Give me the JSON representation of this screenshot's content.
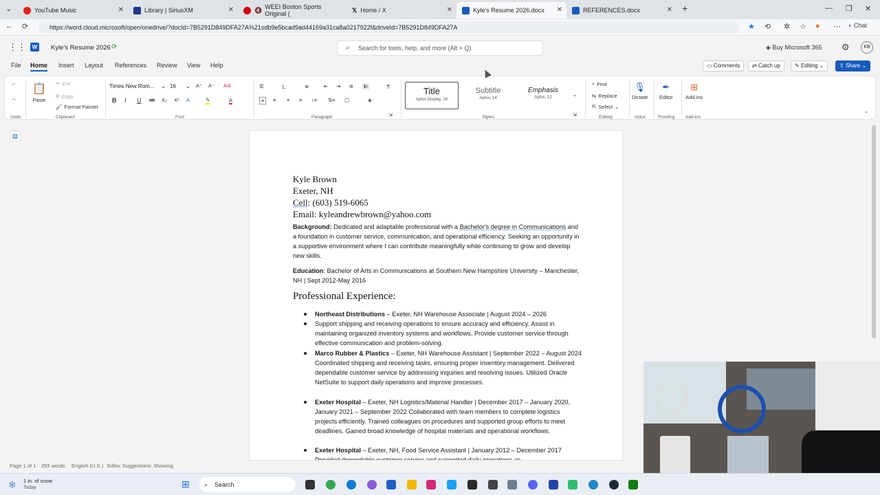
{
  "browser": {
    "tabs": [
      {
        "title": "YouTube Music",
        "color": "#e62117"
      },
      {
        "title": "Library | SiriusXM",
        "color": "#1e3a8a"
      },
      {
        "title": "WEEI Boston Sports Original (",
        "color": "#d40000"
      },
      {
        "title": "Home / X",
        "color": "#000000"
      },
      {
        "title": "Kyle's Resume 2026.docx",
        "color": "#185abd"
      },
      {
        "title": "REFERENCES.docx",
        "color": "#185abd"
      }
    ],
    "new_tab": "+",
    "url": "https://word.cloud.microsoft/open/onedrive/?docId=7B5291D849DFA27A%21sdb9e5bcad9ad44169a31ca8a0217922f&driveId=7B5291D849DFA27A"
  },
  "word": {
    "doc_title": "Kyle's Resume 2026",
    "search_placeholder": "Search for tools, help, and more (Alt + Q)",
    "buy": "Buy Microsoft 365",
    "avatar": "KB",
    "menu": [
      "File",
      "Home",
      "Insert",
      "Layout",
      "References",
      "Review",
      "View",
      "Help"
    ],
    "comments": "Comments",
    "catchup": "Catch up",
    "editing": "Editing",
    "share": "Share",
    "ribbon": {
      "paste": "Paste",
      "cut": "Cut",
      "copy": "Copy",
      "format_painter": "Format Painter",
      "clipboard": "Clipboard",
      "font_name": "Times New Rom...",
      "font_size": "16",
      "font_group": "Font",
      "paragraph_group": "Paragraph",
      "styles": [
        {
          "name": "Title",
          "sub": "Aptos Display, 28"
        },
        {
          "name": "Subtitle",
          "sub": "Aptos, 14"
        },
        {
          "name": "Emphasis",
          "sub": "Aptos, 12"
        }
      ],
      "styles_group": "Styles",
      "find": "Find",
      "replace": "Replace",
      "select": "Select",
      "editing_group": "Editing",
      "dictate": "Dictate",
      "voice_group": "Voice",
      "editor": "Editor",
      "proofing_group": "Proofing",
      "addins": "Add-ins",
      "addins_group": "Add-ins"
    }
  },
  "document": {
    "name": "Kyle Brown",
    "location": "Exeter, NH",
    "cell_label": "Cell",
    "cell": ": (603) 519-6065",
    "email": "Email: kyleandrewbrown@yahoo.com",
    "bg_label": "Background:",
    "bg_pre": " Dedicated and adaptable professional with a ",
    "bg_link": "Bachelor's degree in",
    "bg_link2": "Communications",
    "bg_post": " and a foundation in customer service, communication, and operational efficiency. Seeking an opportunity in a supportive environment where I can contribute meaningfully while continuing to grow and develop new skills.",
    "edu_label": "Education",
    "edu_text": ": Bachelor of Arts in Communications at Southern New Hampshire University – Manchester, NH | Sept 2012-May 2016",
    "exp_heading": "Professional Experience:",
    "jobs": [
      {
        "company": "Northeast Distributions",
        "rest": " – Exeter, NH Warehouse Associate | August 2024 – 2026",
        "desc": "Support shipping and receiving operations to ensure accuracy and efficiency. Assist in maintaining organized inventory systems and workflows. Provide customer service through effective communication and problem-solving."
      },
      {
        "company": "Marco Rubber & Plastics",
        "rest": " – Exeter, NH Warehouse Assistant | September 2022 – August 2024 Coordinated shipping and receiving tasks, ensuring proper inventory management.  Delivered dependable customer service by addressing inquiries and resolving issues.  Utilized Oracle NetSuite to support daily operations and improve processes.",
        "desc": ""
      },
      {
        "company": " Exeter Hospital",
        "rest": " – Exeter, NH Logistics/Material Handler | December 2017 – January 2020, January 2021 – September 2022 Collaborated with team members to complete logistics projects efficiently. Trained colleagues on procedures and supported group efforts to meet deadlines.  Gained broad knowledge of hospital materials and operational workflows.",
        "desc": ""
      },
      {
        "company": "Exeter Hospital",
        "rest": " – Exeter, NH, Food Service Assistant | January 2012 – December 2017 Provided dependable customer service and supported daily operations as",
        "desc": ""
      }
    ]
  },
  "status": {
    "page": "Page 1 of 1",
    "words": "255 words",
    "lang": "English (U.S.)",
    "editor": "Editor Suggestions: Showing"
  },
  "taskbar": {
    "weather": "1 in. of snow",
    "weather_sub": "Today",
    "search": "Search"
  }
}
